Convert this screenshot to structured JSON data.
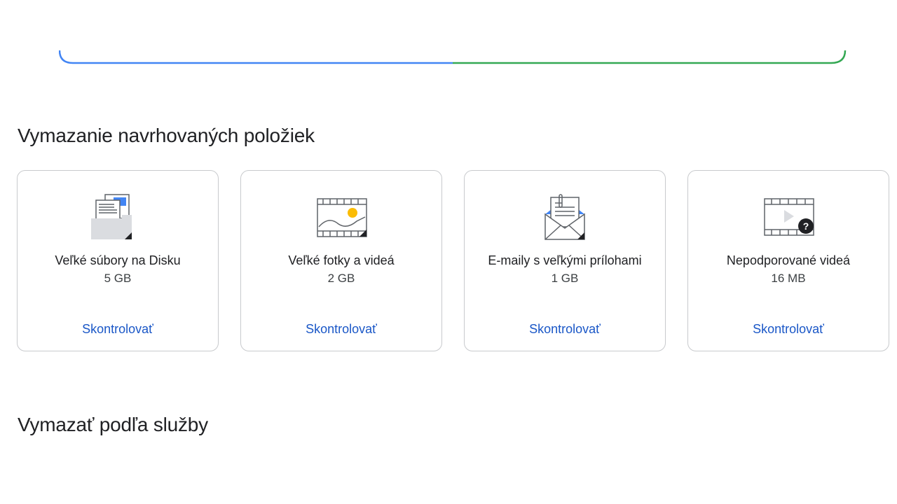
{
  "colors": {
    "progress_left": "#4285f4",
    "progress_right": "#34a853",
    "link": "#1a57c7",
    "card_border": "#c8cacd",
    "accent_yellow": "#fbbc04",
    "accent_blue": "#4285f4"
  },
  "sections": {
    "suggested_title": "Vymazanie navrhovaných položiek",
    "by_service_title": "Vymazať podľa služby"
  },
  "cards": [
    {
      "label": "Veľké súbory na Disku",
      "size": "5 GB",
      "action": "Skontrolovať",
      "icon": "drive-files-icon"
    },
    {
      "label": "Veľké fotky a videá",
      "size": "2 GB",
      "action": "Skontrolovať",
      "icon": "photos-videos-icon"
    },
    {
      "label": "E-maily s veľkými prílohami",
      "size": "1 GB",
      "action": "Skontrolovať",
      "icon": "email-attachments-icon"
    },
    {
      "label": "Nepodporované videá",
      "size": "16 MB",
      "action": "Skontrolovať",
      "icon": "unsupported-video-icon"
    }
  ]
}
